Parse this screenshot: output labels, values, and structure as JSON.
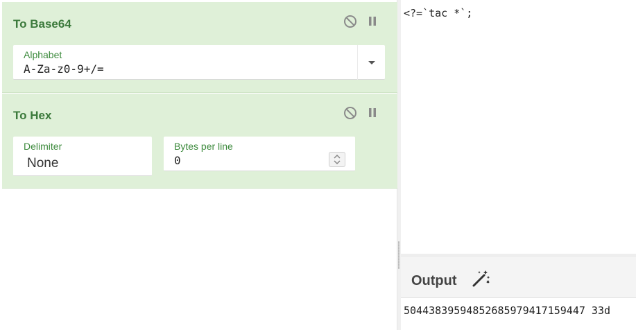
{
  "recipe": {
    "operations": [
      {
        "title": "To Base64",
        "icons": [
          "disable-icon",
          "pause-icon"
        ],
        "fields": {
          "alphabet": {
            "label": "Alphabet",
            "value": "A-Za-z0-9+/="
          }
        }
      },
      {
        "title": "To Hex",
        "icons": [
          "disable-icon",
          "pause-icon"
        ],
        "fields": {
          "delimiter": {
            "label": "Delimiter",
            "value": "None"
          },
          "bytes_per_line": {
            "label": "Bytes per line",
            "value": "0"
          }
        }
      }
    ]
  },
  "input": {
    "text": "<?=`tac *`;"
  },
  "output": {
    "title": "Output",
    "icon": "magic-wand-icon",
    "text": "50443839594852685979417159447 33d"
  },
  "colors": {
    "operation_bg": "#dff0d8",
    "operation_title": "#3c7a3c",
    "field_label": "#3c8a3c"
  }
}
